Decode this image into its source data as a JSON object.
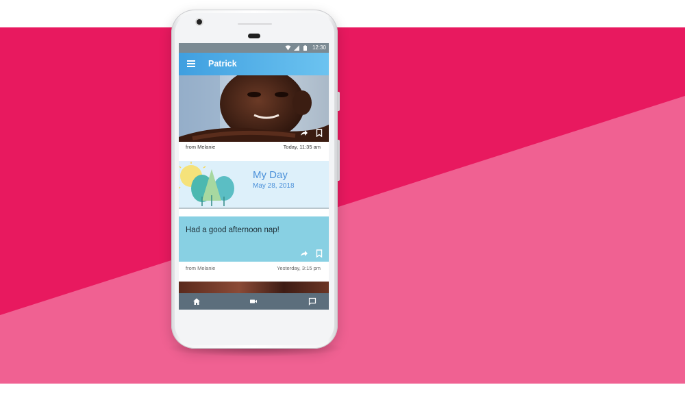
{
  "colors": {
    "magenta": "#e8195f",
    "pink": "#f06192",
    "appbar": "#4aa9e6",
    "bottom_nav": "#5c6e7c"
  },
  "status_bar": {
    "time": "12:30",
    "icons": [
      "wifi-icon",
      "signal-icon",
      "battery-icon"
    ]
  },
  "app_bar": {
    "title": "Patrick",
    "menu_icon": "hamburger-menu-icon"
  },
  "feed": {
    "photo_post": {
      "from": "from Melanie",
      "time": "Today, 11:35 am",
      "actions": [
        "share-icon",
        "bookmark-icon"
      ]
    },
    "my_day": {
      "title": "My Day",
      "date": "May 28, 2018"
    },
    "note_post": {
      "text": "Had a good afternoon nap!",
      "from": "from Melanie",
      "time": "Yesterday, 3:15 pm",
      "actions": [
        "share-icon",
        "bookmark-icon"
      ]
    }
  },
  "bottom_nav": {
    "items": [
      "home-icon",
      "video-icon",
      "chat-icon"
    ]
  }
}
